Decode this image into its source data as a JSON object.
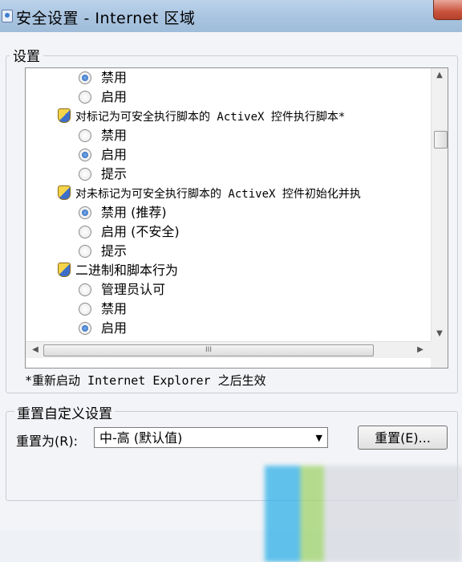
{
  "window": {
    "title": "安全设置 - Internet 区域"
  },
  "settings_group": {
    "label": "设置"
  },
  "tree": {
    "row1": {
      "label": "禁用",
      "checked": true
    },
    "row2": {
      "label": "启用",
      "checked": false
    },
    "cat1": {
      "label": "对标记为可安全执行脚本的 ActiveX 控件执行脚本*"
    },
    "row3": {
      "label": "禁用",
      "checked": false
    },
    "row4": {
      "label": "启用",
      "checked": true
    },
    "row5": {
      "label": "提示",
      "checked": false
    },
    "cat2": {
      "label": "对未标记为可安全执行脚本的 ActiveX 控件初始化并执"
    },
    "row6": {
      "label": "禁用 (推荐)",
      "checked": true
    },
    "row7": {
      "label": "启用 (不安全)",
      "checked": false
    },
    "row8": {
      "label": "提示",
      "checked": false
    },
    "cat3": {
      "label": "二进制和脚本行为"
    },
    "row9": {
      "label": "管理员认可",
      "checked": false
    },
    "row10": {
      "label": "禁用",
      "checked": false
    },
    "row11": {
      "label": "启用",
      "checked": true
    }
  },
  "scrollbar": {
    "h_grip": "III"
  },
  "restart_note": "*重新启动 Internet Explorer 之后生效",
  "reset": {
    "group_label": "重置自定义设置",
    "reset_to_label": "重置为(R):",
    "selected_level": "中-高 (默认值)",
    "button_label": "重置(E)..."
  },
  "icons": {
    "app": "shield-window-icon",
    "category": "script-settings-icon"
  }
}
